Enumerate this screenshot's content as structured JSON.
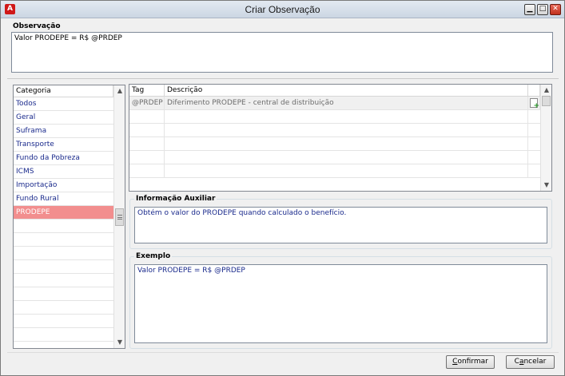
{
  "window": {
    "title": "Criar Observação",
    "min_glyph": "▁",
    "max_glyph": "□",
    "close_glyph": "✕"
  },
  "observacao": {
    "label": "Observação",
    "value": "Valor PRODEPE = R$ @PRDEP"
  },
  "categories": {
    "header": "Categoria",
    "selected": "PRODEPE",
    "items": [
      "Todos",
      "Geral",
      "Suframa",
      "Transporte",
      "Fundo da Pobreza",
      "ICMS",
      "Importação",
      "Fundo Rural",
      "PRODEPE"
    ]
  },
  "tags": {
    "columns": [
      "Tag",
      "Descrição"
    ],
    "rows": [
      {
        "tag": "@PRDEP",
        "descricao": "Diferimento PRODEPE - central de distribuição"
      }
    ]
  },
  "info": {
    "label": "Informação Auxiliar",
    "text": "Obtém o valor do PRODEPE quando calculado o benefício."
  },
  "example": {
    "label": "Exemplo",
    "text": "Valor PRODEPE = R$ @PRDEP"
  },
  "buttons": {
    "confirm_mnemonic": "C",
    "confirm_rest": "onfirmar",
    "cancel_first": "C",
    "cancel_mnemonic": "a",
    "cancel_rest": "ncelar"
  },
  "colors": {
    "selected_row": "#f28e8e",
    "link_text": "#1a2a8c",
    "close_button": "#c0301c"
  },
  "icons": [
    "app-icon",
    "minimize-icon",
    "maximize-icon",
    "close-icon",
    "scroll-up-icon",
    "scroll-down-icon",
    "add-tag-icon"
  ]
}
